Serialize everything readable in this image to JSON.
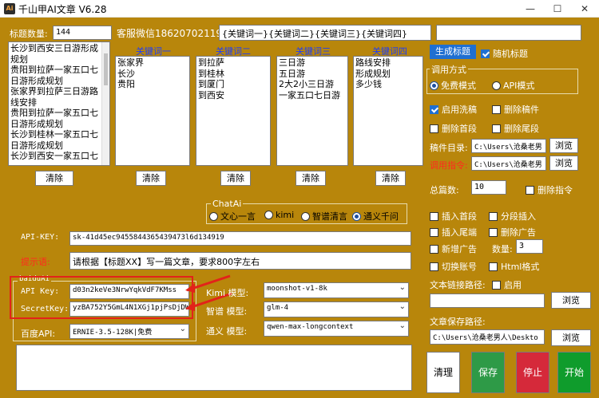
{
  "window": {
    "title": "千山甲AI文章 V6.28",
    "icon_text": "Ai"
  },
  "title_count": {
    "label": "标题数量:",
    "value": "144"
  },
  "wechat": "客服微信18620702119",
  "keyword_template": "{关键词一}{关键词二}{关键词三}{关键词四}",
  "titles_list": [
    "长沙到西安三日游形成",
    "规划",
    "贵阳到拉萨一家五口七",
    "日游形成规划",
    "张家界到拉萨三日游路",
    "线安排",
    "贵阳到拉萨一家五口七",
    "日游形成规划",
    "长沙到桂林一家五口七",
    "日游形成规划",
    "长沙到西安一家五口七"
  ],
  "keywords": [
    {
      "header": "关键词一",
      "items": [
        "张家界",
        "长沙",
        "贵阳"
      ]
    },
    {
      "header": "关键词二",
      "items": [
        "到拉萨",
        "到桂林",
        "到厦门",
        "到西安"
      ]
    },
    {
      "header": "关键词三",
      "items": [
        "三日游",
        "五日游",
        "2大2小三日游",
        "一家五口七日游"
      ]
    },
    {
      "header": "关键词四",
      "items": [
        "路线安排",
        "形成规划",
        "多少钱"
      ]
    }
  ],
  "clear_label": "清除",
  "chatai": {
    "title": "ChatAi",
    "options": [
      "文心一言",
      "kimi",
      "智谱清言",
      "通义千问"
    ],
    "selected": "通义千问"
  },
  "api_key": {
    "label": "API-KEY:",
    "value": "sk-41d45ec9455844365439473l6d134919"
  },
  "prompt": {
    "label": "提示语:",
    "value": "请根据【标题XX】写一篇文章，要求800字左右"
  },
  "baidu": {
    "title": "baiduAi",
    "api_key_label": "API Key:",
    "api_key_value": "d03n2keVe3NrwYqkVdF7KMss",
    "secret_label": "SecretKey:",
    "secret_value": "yzBA752Y5GmL4N1XGj1pjPsDjDW:",
    "baidu_api_label": "百度API:",
    "baidu_api_value": "ERNIE-3.5-128K|免费"
  },
  "models": [
    {
      "label": "Kimi 模型:",
      "value": "moonshot-v1-8k"
    },
    {
      "label": "智谱 模型:",
      "value": "glm-4"
    },
    {
      "label": "通义 模型:",
      "value": "qwen-max-longcontext"
    }
  ],
  "right": {
    "generate_title": "生成标题",
    "random_title": "随机标题",
    "call_mode_title": "调用方式",
    "call_modes": [
      "免费模式",
      "API模式"
    ],
    "call_mode_selected": "免费模式",
    "enable_wash": "启用洗稿",
    "delete_draft": "删除稿件",
    "delete_first": "删除首段",
    "delete_last": "删除尾段",
    "draft_dir_label": "稿件目录:",
    "draft_dir_value": "C:\\Users\\沧桑老男",
    "browse": "浏览",
    "call_cmd_label": "调用指令:",
    "call_cmd_value": "C:\\Users\\沧桑老男",
    "total_label": "总篇数:",
    "total_value": "10",
    "delete_cmd": "删除指令",
    "insert_first": "插入首段",
    "segment_insert": "分段插入",
    "insert_tail": "插入尾端",
    "delete_ads": "删除广告",
    "add_ads": "新增广告",
    "count_label": "数量:",
    "count_value": "3",
    "switch_account": "切换账号",
    "html_format": "Html格式",
    "link_path_label": "文本链接路径:",
    "enable": "启用",
    "save_path_label": "文章保存路径:",
    "save_path_value": "C:\\Users\\沧桑老男人\\Deskto",
    "clean": "清理",
    "save": "保存",
    "stop": "停止",
    "start": "开始",
    "colors": {
      "save": "#2e9a47",
      "stop": "#d5293a",
      "start": "#0f9c2c"
    }
  }
}
